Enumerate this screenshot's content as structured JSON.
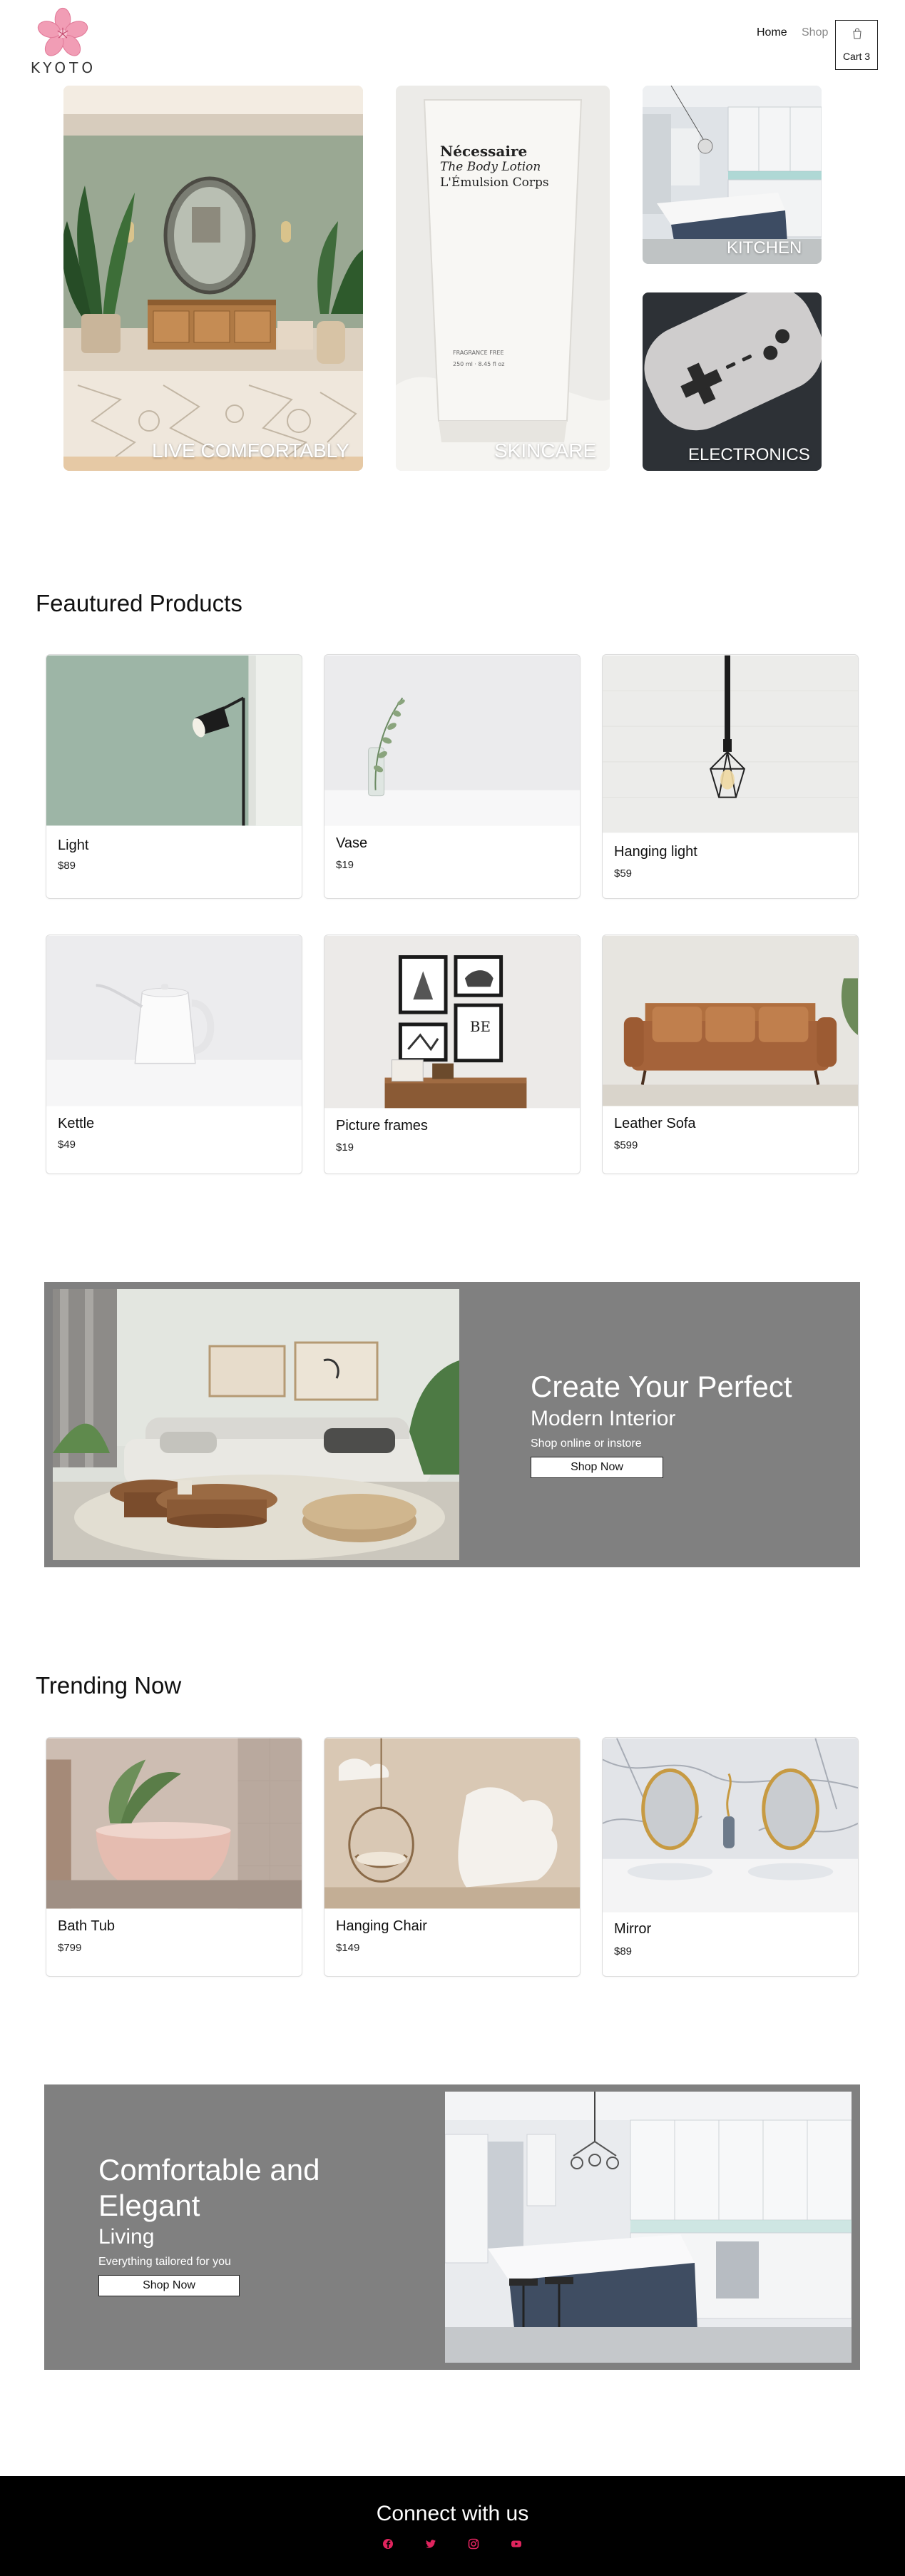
{
  "header": {
    "logo_text": "KYOTO",
    "nav": {
      "home": "Home",
      "shop": "Shop"
    },
    "cart_label": "Cart 3"
  },
  "hero": {
    "tiles": [
      {
        "label": "LIVE COMFORTABLY"
      },
      {
        "label": "SKINCARE",
        "product_text": [
          "Nécessaire",
          "The Body Lotion",
          "L'Émulsion Corps"
        ],
        "product_small": [
          "FRAGRANCE FREE",
          "250 ml · 8.45 fl oz"
        ]
      },
      {
        "label": "KITCHEN"
      },
      {
        "label": "ELECTRONICS"
      }
    ]
  },
  "featured": {
    "title": "Feautured Products",
    "products": [
      {
        "name": "Light",
        "price": "$89"
      },
      {
        "name": "Vase",
        "price": "$19"
      },
      {
        "name": "Hanging light",
        "price": "$59"
      },
      {
        "name": "Kettle",
        "price": "$49"
      },
      {
        "name": "Picture frames",
        "price": "$19"
      },
      {
        "name": "Leather Sofa",
        "price": "$599"
      }
    ]
  },
  "banner1": {
    "heading": "Create Your Perfect",
    "subheading": "Modern Interior",
    "text": "Shop online or instore",
    "button": "Shop Now"
  },
  "trending": {
    "title": "Trending Now",
    "products": [
      {
        "name": "Bath Tub",
        "price": "$799"
      },
      {
        "name": "Hanging Chair",
        "price": "$149"
      },
      {
        "name": "Mirror",
        "price": "$89"
      }
    ]
  },
  "banner2": {
    "heading_line1": "Comfortable and",
    "heading_line2": "Elegant",
    "subheading": "Living",
    "text": "Everything tailored for you",
    "button": "Shop Now"
  },
  "footer": {
    "title": "Connect with us",
    "social_icons": [
      "facebook-icon",
      "twitter-icon",
      "instagram-icon",
      "youtube-icon"
    ],
    "icon_color": "#e0245e"
  },
  "colors": {
    "banner_bg": "#808080",
    "footer_bg": "#000000",
    "logo_pink": "#f19db5"
  }
}
